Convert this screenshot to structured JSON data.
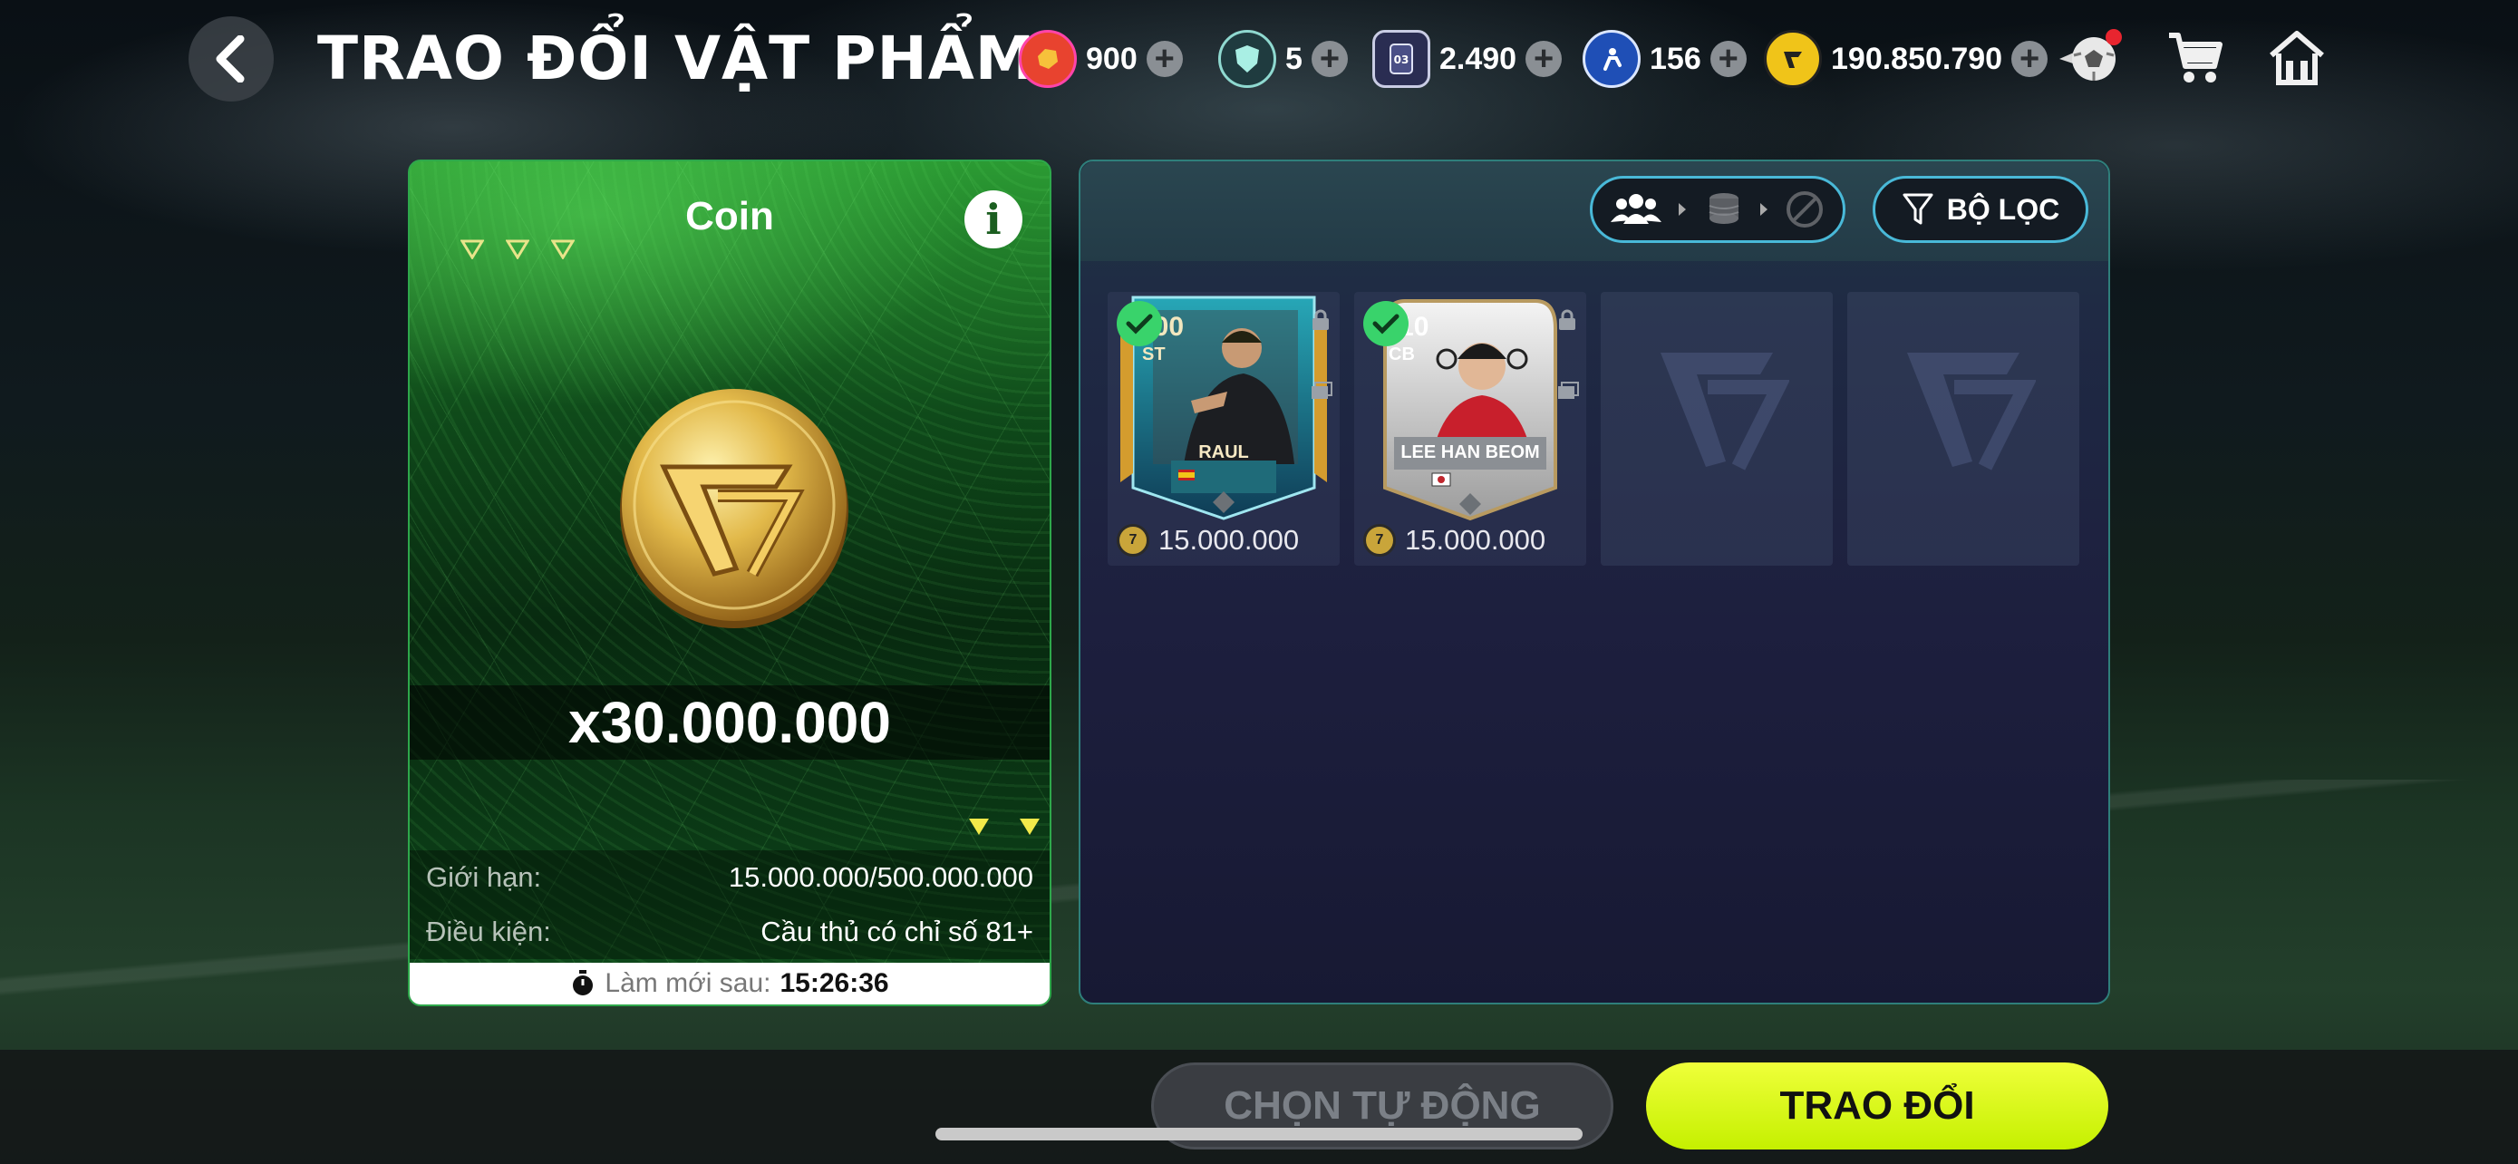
{
  "header": {
    "title": "TRAO ĐỔI VẬT PHẨM",
    "currencies": [
      {
        "icon": "red-token-icon",
        "value": "900",
        "color": "#e8432f"
      },
      {
        "icon": "shield-token-icon",
        "value": "5",
        "color": "#8fd9d0"
      },
      {
        "icon": "card-token-icon",
        "value": "2.490",
        "color": "#c9cce4"
      },
      {
        "icon": "player-token-icon",
        "value": "156",
        "color": "#2f6fe0"
      },
      {
        "icon": "fc-coin-icon",
        "value": "190.850.790",
        "color": "#f0c419"
      }
    ]
  },
  "reward": {
    "title": "Coin",
    "amount": "x30.000.000",
    "limit_label": "Giới hạn:",
    "limit_value": "15.000.000/500.000.000",
    "condition_label": "Điều kiện:",
    "condition_value": "Cầu thủ có chỉ số 81+",
    "refresh_label": "Làm mới sau:",
    "refresh_time": "15:26:36"
  },
  "panel": {
    "filter_label": "BỘ LỌC"
  },
  "players": [
    {
      "rating": "100",
      "position": "ST",
      "name": "RAUL",
      "price": "15.000.000",
      "selected": true,
      "color": "#2a8a9a"
    },
    {
      "rating": "110",
      "position": "CB",
      "name": "LEE HAN BEOM",
      "price": "15.000.000",
      "selected": true,
      "color": "#c9c9c9"
    }
  ],
  "buttons": {
    "auto_select": "CHỌN TỰ ĐỘNG",
    "trade": "TRAO ĐỔI"
  }
}
